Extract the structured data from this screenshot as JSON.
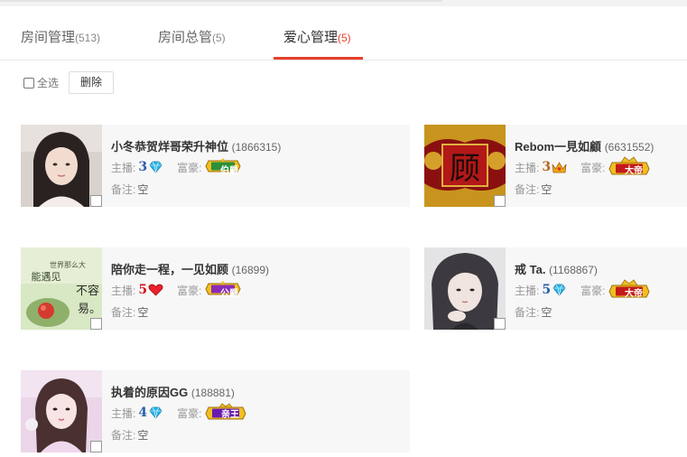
{
  "tabs": [
    {
      "label": "房间管理",
      "count": "(513)"
    },
    {
      "label": "房间总管",
      "count": "(5)"
    },
    {
      "label": "爱心管理",
      "count": "(5)"
    }
  ],
  "toolbar": {
    "select_all": "全选",
    "delete": "删除"
  },
  "labels": {
    "anchor": "主播:",
    "rich": "富豪:",
    "note": "备注:"
  },
  "cards": [
    {
      "name": "小冬恭贺烊哥荣升神位",
      "id": "(1866315)",
      "anchor_level": "3",
      "anchor_icon": "diamond-icon",
      "rich_badge": "伯爵",
      "note": "空",
      "level_color": "#2a5fa8"
    },
    {
      "name": "Rebom一見如顧",
      "id": "(6631552)",
      "anchor_level": "3",
      "anchor_icon": "crown-icon",
      "rich_badge": "大帝",
      "note": "空",
      "level_color": "#b5651d"
    },
    {
      "name": "陪你走一程，一见如顾",
      "id": "(16899)",
      "anchor_level": "5",
      "anchor_icon": "heart-icon",
      "rich_badge": "公爵",
      "note": "空",
      "level_color": "#d4161f"
    },
    {
      "name": "戒 Ta.",
      "id": "(1168867)",
      "anchor_level": "5",
      "anchor_icon": "diamond-icon",
      "rich_badge": "大帝",
      "note": "空",
      "level_color": "#2a5fa8"
    },
    {
      "name": "执着的原因GG",
      "id": "(188881)",
      "anchor_level": "4",
      "anchor_icon": "diamond-icon",
      "rich_badge": "亲王",
      "note": "空",
      "level_color": "#2a5fa8"
    }
  ],
  "avatar_texts": {
    "card0": "",
    "card1": "顾",
    "card2_line1": "世界那么大",
    "card2_line2": "能遇见",
    "card2_line3": "不容",
    "card2_line4": "易。"
  }
}
